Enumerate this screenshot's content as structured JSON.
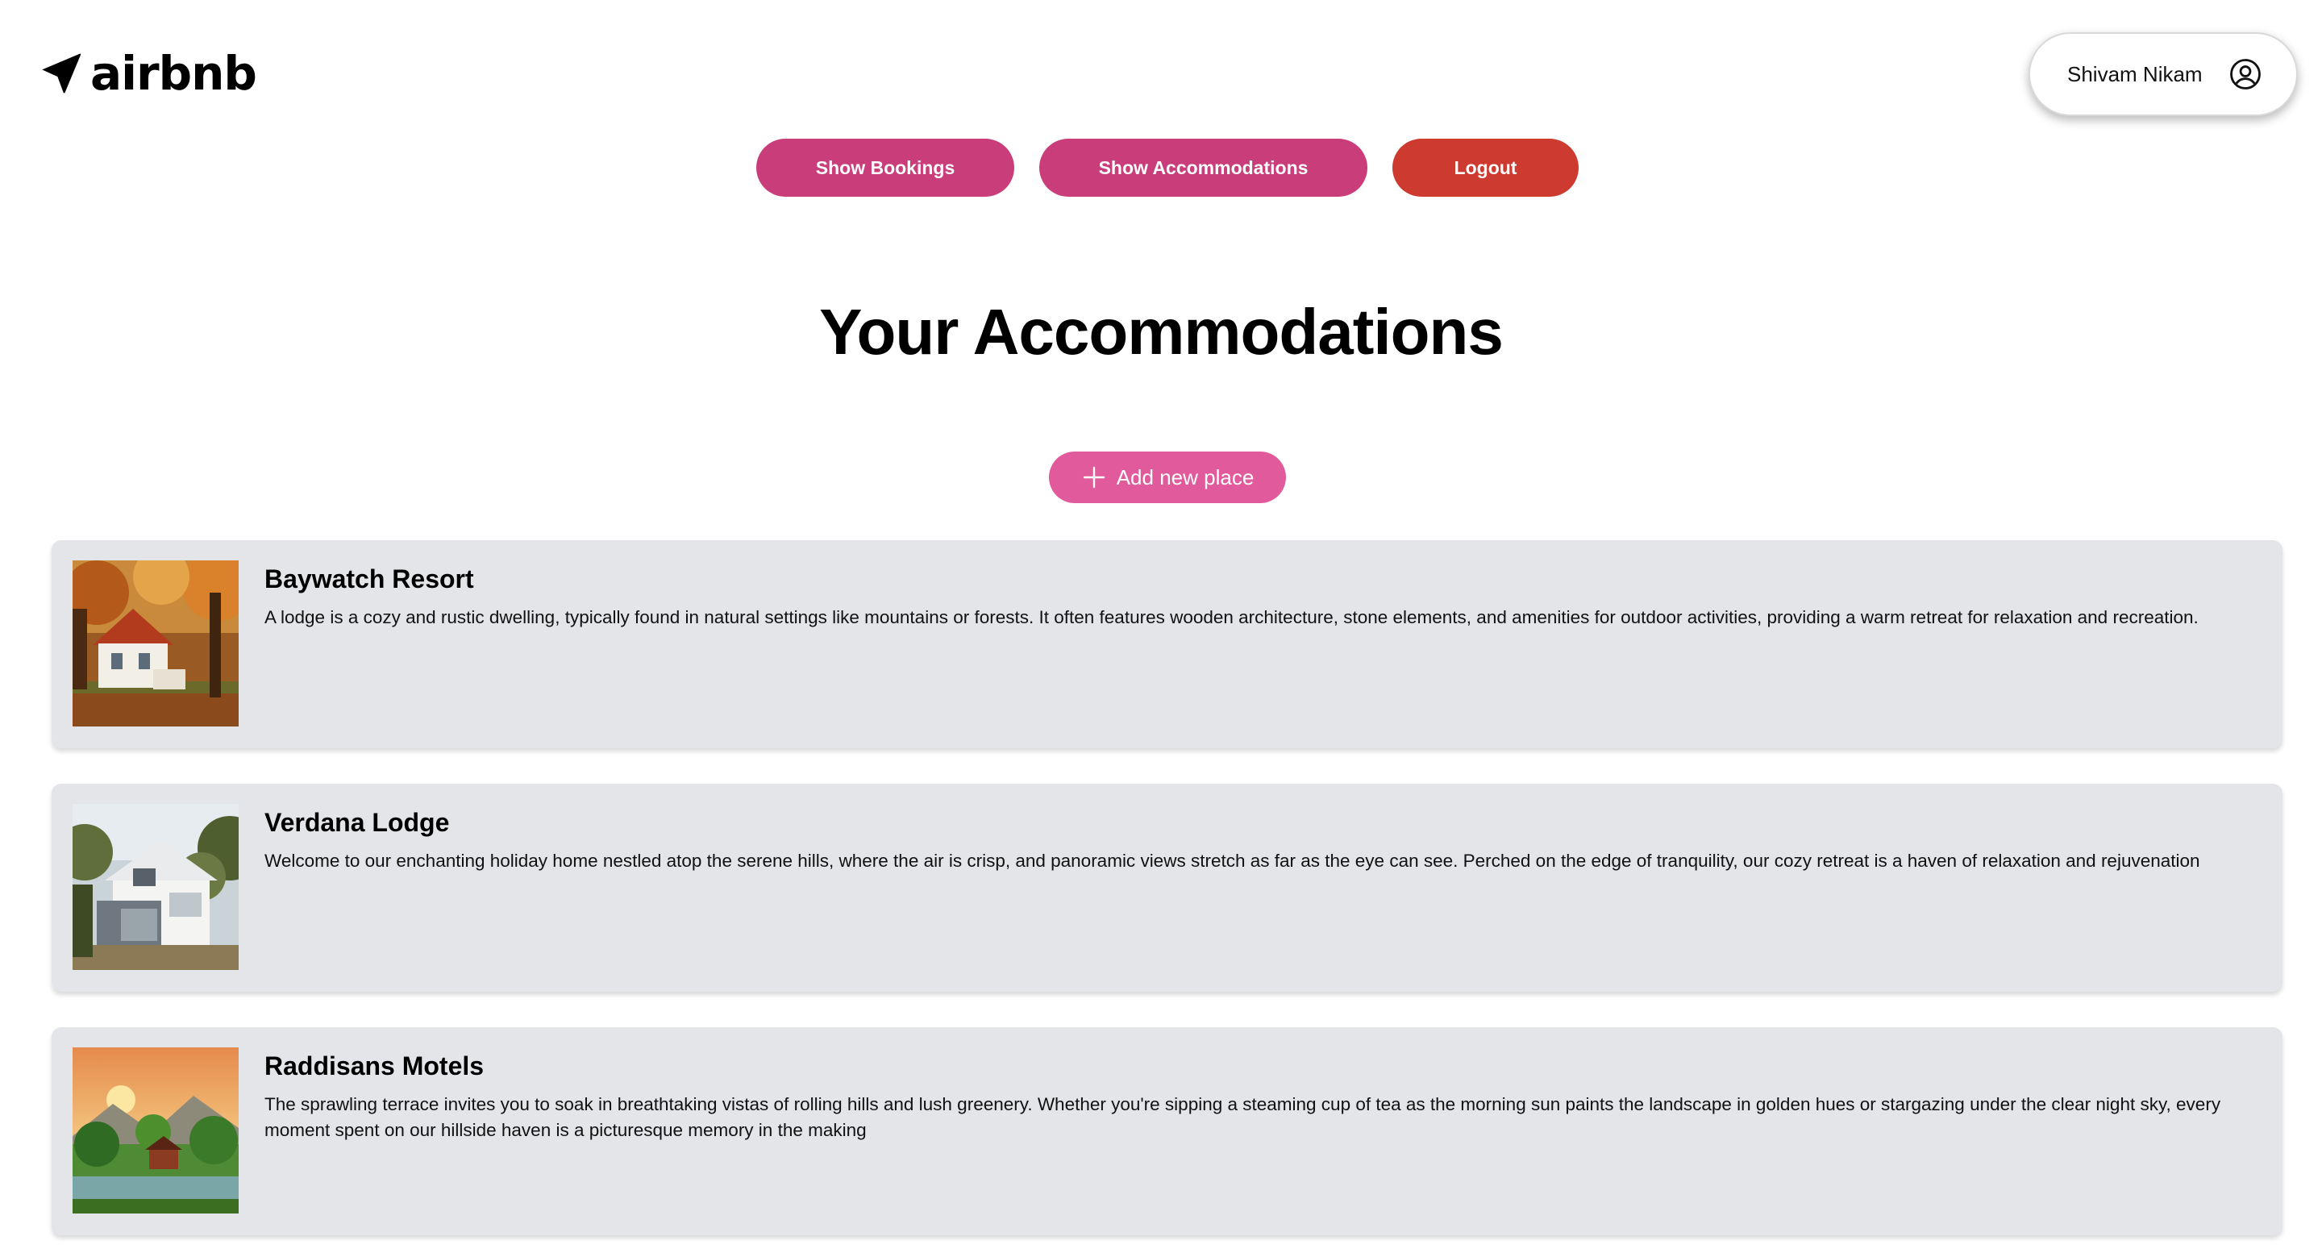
{
  "header": {
    "logo_text": "airbnb",
    "logo_icon": "paper-plane-icon",
    "user_name": "Shivam Nikam",
    "user_icon": "user-circle-icon"
  },
  "nav": {
    "bookings_label": "Show Bookings",
    "accommodations_label": "Show Accommodations",
    "logout_label": "Logout"
  },
  "page": {
    "title": "Your Accommodations",
    "add_label": "Add new place",
    "add_icon": "plus-icon"
  },
  "colors": {
    "pink_button": "#c93e7a",
    "logout_button": "#cc3a30",
    "add_button": "#e05a9c",
    "card_background": "#e4e5e9"
  },
  "places": [
    {
      "title": "Baywatch Resort",
      "description": "A lodge is a cozy and rustic dwelling, typically found in natural settings like mountains or forests. It often features wooden architecture, stone elements, and amenities for outdoor activities, providing a warm retreat for relaxation and recreation."
    },
    {
      "title": "Verdana Lodge",
      "description": "Welcome to our enchanting holiday home nestled atop the serene hills, where the air is crisp, and panoramic views stretch as far as the eye can see. Perched on the edge of tranquility, our cozy retreat is a haven of relaxation and rejuvenation"
    },
    {
      "title": "Raddisans Motels",
      "description": "The sprawling terrace invites you to soak in breathtaking vistas of rolling hills and lush greenery. Whether you're sipping a steaming cup of tea as the morning sun paints the landscape in golden hues or stargazing under the clear night sky, every moment spent on our hillside haven is a picturesque memory in the making"
    }
  ]
}
